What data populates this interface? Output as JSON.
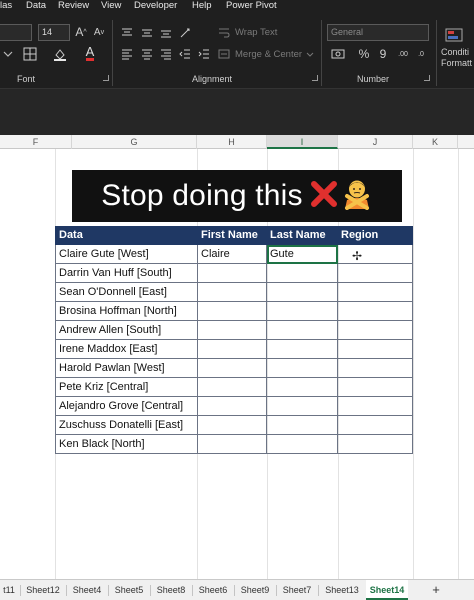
{
  "menu": [
    "las",
    "Data",
    "Review",
    "View",
    "Developer",
    "Help",
    "Power Pivot"
  ],
  "ribbon": {
    "font_size": "14",
    "font_group_label": "Font",
    "alignment_group_label": "Alignment",
    "number_group_label": "Number",
    "wrap_text_label": "Wrap Text",
    "merge_center_label": "Merge & Center",
    "number_format": "General",
    "conditional_label_1": "Conditi",
    "conditional_label_2": "Formatt"
  },
  "columns": [
    "F",
    "G",
    "H",
    "I",
    "J",
    "K"
  ],
  "banner": {
    "text": "Stop doing this"
  },
  "table": {
    "headers": [
      "Data",
      "First Name",
      "Last Name",
      "Region"
    ],
    "rows": [
      [
        "Claire Gute [West]",
        "Claire",
        "Gute",
        ""
      ],
      [
        "Darrin Van Huff [South]",
        "",
        "",
        ""
      ],
      [
        "Sean O'Donnell [East]",
        "",
        "",
        ""
      ],
      [
        "Brosina Hoffman [North]",
        "",
        "",
        ""
      ],
      [
        "Andrew Allen [South]",
        "",
        "",
        ""
      ],
      [
        "Irene Maddox [East]",
        "",
        "",
        ""
      ],
      [
        "Harold Pawlan [West]",
        "",
        "",
        ""
      ],
      [
        "Pete Kriz [Central]",
        "",
        "",
        ""
      ],
      [
        "Alejandro Grove [Central]",
        "",
        "",
        ""
      ],
      [
        "Zuschuss Donatelli [East]",
        "",
        "",
        ""
      ],
      [
        "Ken Black [North]",
        "",
        "",
        ""
      ]
    ]
  },
  "sheet_tabs": [
    "t11",
    "Sheet12",
    "Sheet4",
    "Sheet5",
    "Sheet8",
    "Sheet6",
    "Sheet9",
    "Sheet7",
    "Sheet13",
    "Sheet14"
  ],
  "active_sheet": "Sheet14",
  "add_sheet": "+",
  "colors": {
    "header_fill": "#1f3864",
    "accent": "#1d7345",
    "banner_bg": "#111111"
  }
}
